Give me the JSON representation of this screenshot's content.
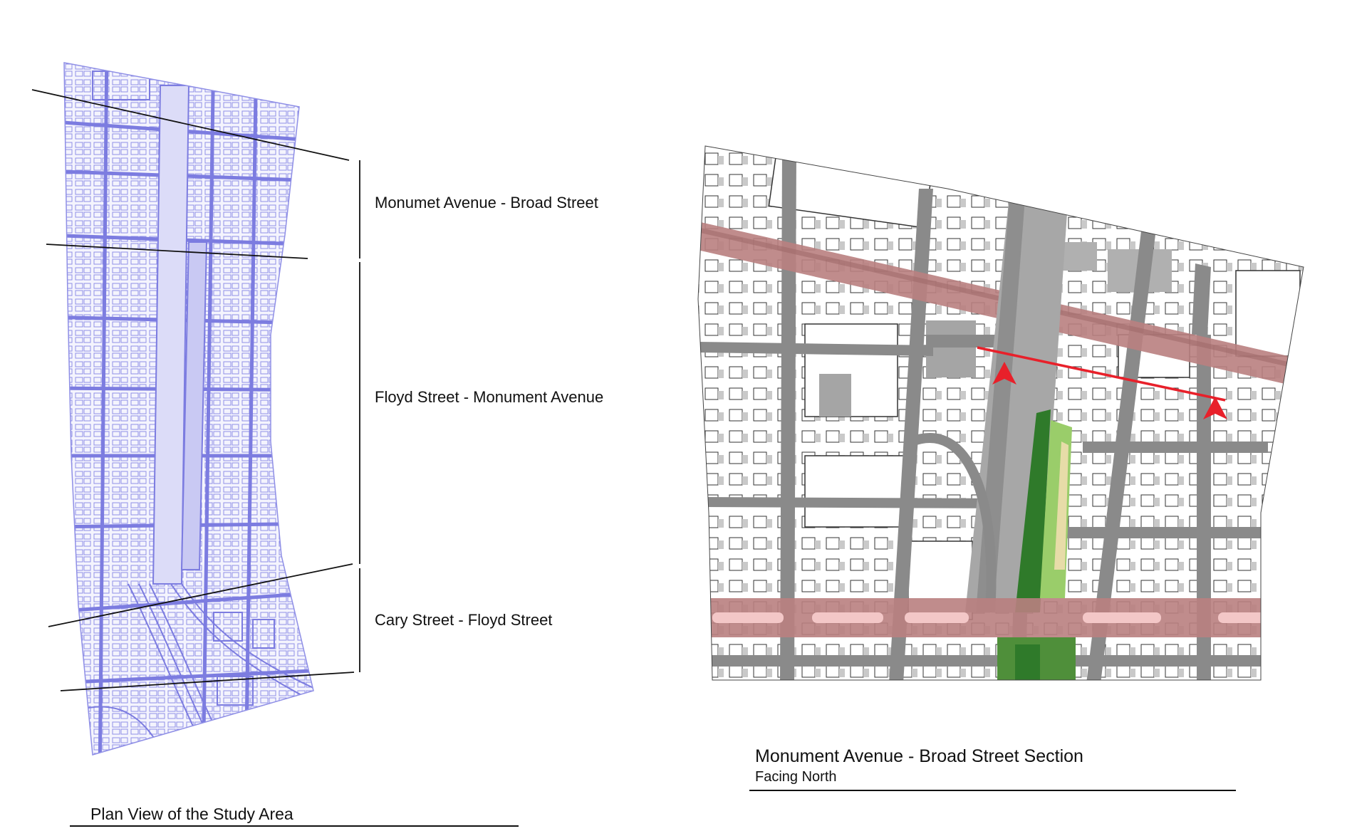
{
  "plan_view": {
    "segments": [
      {
        "label": "Monumet Avenue - Broad Street"
      },
      {
        "label": "Floyd Street - Monument Avenue"
      },
      {
        "label": "Cary Street - Floyd Street"
      }
    ],
    "caption": "Plan View of the Study Area"
  },
  "section_view": {
    "title": "Monument Avenue - Broad Street Section",
    "subtitle": "Facing North"
  },
  "colors": {
    "plan_lines": "#8f8fe6",
    "plan_fill": "#e6e6fb",
    "street": "#8a8a8a",
    "highlight_band": "#b98080",
    "section_line": "#e8202a",
    "green": "#2f7a2a"
  }
}
